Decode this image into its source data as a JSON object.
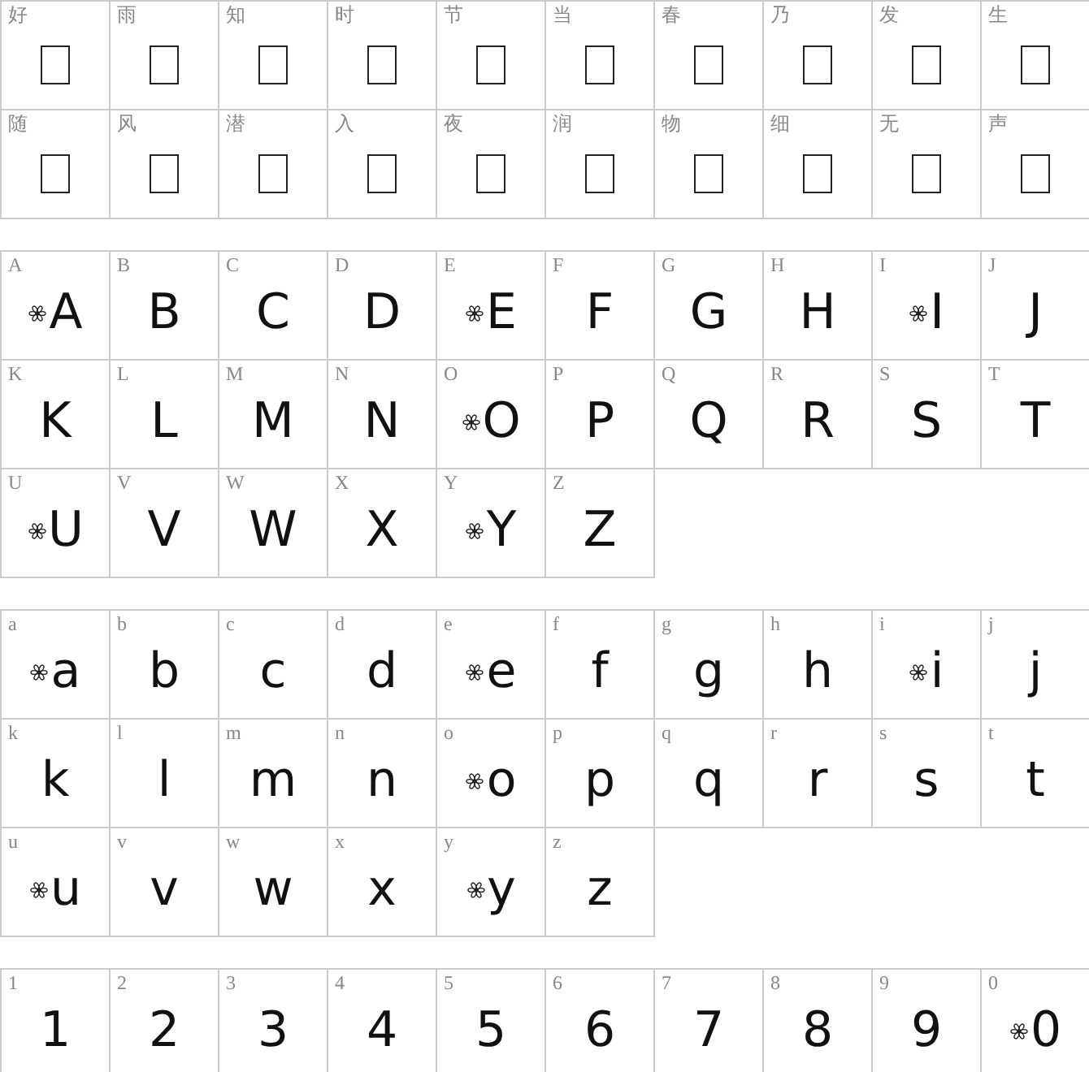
{
  "sections": [
    {
      "kind": "missing",
      "cells": [
        {
          "label": "好"
        },
        {
          "label": "雨"
        },
        {
          "label": "知"
        },
        {
          "label": "时"
        },
        {
          "label": "节"
        },
        {
          "label": "当"
        },
        {
          "label": "春"
        },
        {
          "label": "乃"
        },
        {
          "label": "发"
        },
        {
          "label": "生"
        },
        {
          "label": "随"
        },
        {
          "label": "风"
        },
        {
          "label": "潜"
        },
        {
          "label": "入"
        },
        {
          "label": "夜"
        },
        {
          "label": "润"
        },
        {
          "label": "物"
        },
        {
          "label": "细"
        },
        {
          "label": "无"
        },
        {
          "label": "声"
        }
      ]
    },
    {
      "kind": "glyph",
      "cells": [
        {
          "label": "A",
          "glyph": "A",
          "ornament": true
        },
        {
          "label": "B",
          "glyph": "B",
          "ornament": false
        },
        {
          "label": "C",
          "glyph": "C",
          "ornament": false
        },
        {
          "label": "D",
          "glyph": "D",
          "ornament": false
        },
        {
          "label": "E",
          "glyph": "E",
          "ornament": true
        },
        {
          "label": "F",
          "glyph": "F",
          "ornament": false
        },
        {
          "label": "G",
          "glyph": "G",
          "ornament": false
        },
        {
          "label": "H",
          "glyph": "H",
          "ornament": false
        },
        {
          "label": "I",
          "glyph": "I",
          "ornament": true
        },
        {
          "label": "J",
          "glyph": "J",
          "ornament": false
        },
        {
          "label": "K",
          "glyph": "K",
          "ornament": false
        },
        {
          "label": "L",
          "glyph": "L",
          "ornament": false
        },
        {
          "label": "M",
          "glyph": "M",
          "ornament": false
        },
        {
          "label": "N",
          "glyph": "N",
          "ornament": false
        },
        {
          "label": "O",
          "glyph": "O",
          "ornament": true
        },
        {
          "label": "P",
          "glyph": "P",
          "ornament": false
        },
        {
          "label": "Q",
          "glyph": "Q",
          "ornament": false
        },
        {
          "label": "R",
          "glyph": "R",
          "ornament": false
        },
        {
          "label": "S",
          "glyph": "S",
          "ornament": false
        },
        {
          "label": "T",
          "glyph": "T",
          "ornament": false
        },
        {
          "label": "U",
          "glyph": "U",
          "ornament": true
        },
        {
          "label": "V",
          "glyph": "V",
          "ornament": false
        },
        {
          "label": "W",
          "glyph": "W",
          "ornament": false
        },
        {
          "label": "X",
          "glyph": "X",
          "ornament": false
        },
        {
          "label": "Y",
          "glyph": "Y",
          "ornament": true
        },
        {
          "label": "Z",
          "glyph": "Z",
          "ornament": false
        }
      ]
    },
    {
      "kind": "glyph",
      "cells": [
        {
          "label": "a",
          "glyph": "a",
          "ornament": true
        },
        {
          "label": "b",
          "glyph": "b",
          "ornament": false
        },
        {
          "label": "c",
          "glyph": "c",
          "ornament": false
        },
        {
          "label": "d",
          "glyph": "d",
          "ornament": false
        },
        {
          "label": "e",
          "glyph": "e",
          "ornament": true
        },
        {
          "label": "f",
          "glyph": "f",
          "ornament": false
        },
        {
          "label": "g",
          "glyph": "g",
          "ornament": false
        },
        {
          "label": "h",
          "glyph": "h",
          "ornament": false
        },
        {
          "label": "i",
          "glyph": "i",
          "ornament": true
        },
        {
          "label": "j",
          "glyph": "j",
          "ornament": false
        },
        {
          "label": "k",
          "glyph": "k",
          "ornament": false
        },
        {
          "label": "l",
          "glyph": "l",
          "ornament": false
        },
        {
          "label": "m",
          "glyph": "m",
          "ornament": false
        },
        {
          "label": "n",
          "glyph": "n",
          "ornament": false
        },
        {
          "label": "o",
          "glyph": "o",
          "ornament": true
        },
        {
          "label": "p",
          "glyph": "p",
          "ornament": false
        },
        {
          "label": "q",
          "glyph": "q",
          "ornament": false
        },
        {
          "label": "r",
          "glyph": "r",
          "ornament": false
        },
        {
          "label": "s",
          "glyph": "s",
          "ornament": false
        },
        {
          "label": "t",
          "glyph": "t",
          "ornament": false
        },
        {
          "label": "u",
          "glyph": "u",
          "ornament": true
        },
        {
          "label": "v",
          "glyph": "v",
          "ornament": false
        },
        {
          "label": "w",
          "glyph": "w",
          "ornament": false
        },
        {
          "label": "x",
          "glyph": "x",
          "ornament": false
        },
        {
          "label": "y",
          "glyph": "y",
          "ornament": true
        },
        {
          "label": "z",
          "glyph": "z",
          "ornament": false
        }
      ]
    },
    {
      "kind": "glyph",
      "cells": [
        {
          "label": "1",
          "glyph": "1",
          "ornament": false
        },
        {
          "label": "2",
          "glyph": "2",
          "ornament": false
        },
        {
          "label": "3",
          "glyph": "3",
          "ornament": false
        },
        {
          "label": "4",
          "glyph": "4",
          "ornament": false
        },
        {
          "label": "5",
          "glyph": "5",
          "ornament": false
        },
        {
          "label": "6",
          "glyph": "6",
          "ornament": false
        },
        {
          "label": "7",
          "glyph": "7",
          "ornament": false
        },
        {
          "label": "8",
          "glyph": "8",
          "ornament": false
        },
        {
          "label": "9",
          "glyph": "9",
          "ornament": false
        },
        {
          "label": "0",
          "glyph": "0",
          "ornament": true
        }
      ]
    }
  ]
}
